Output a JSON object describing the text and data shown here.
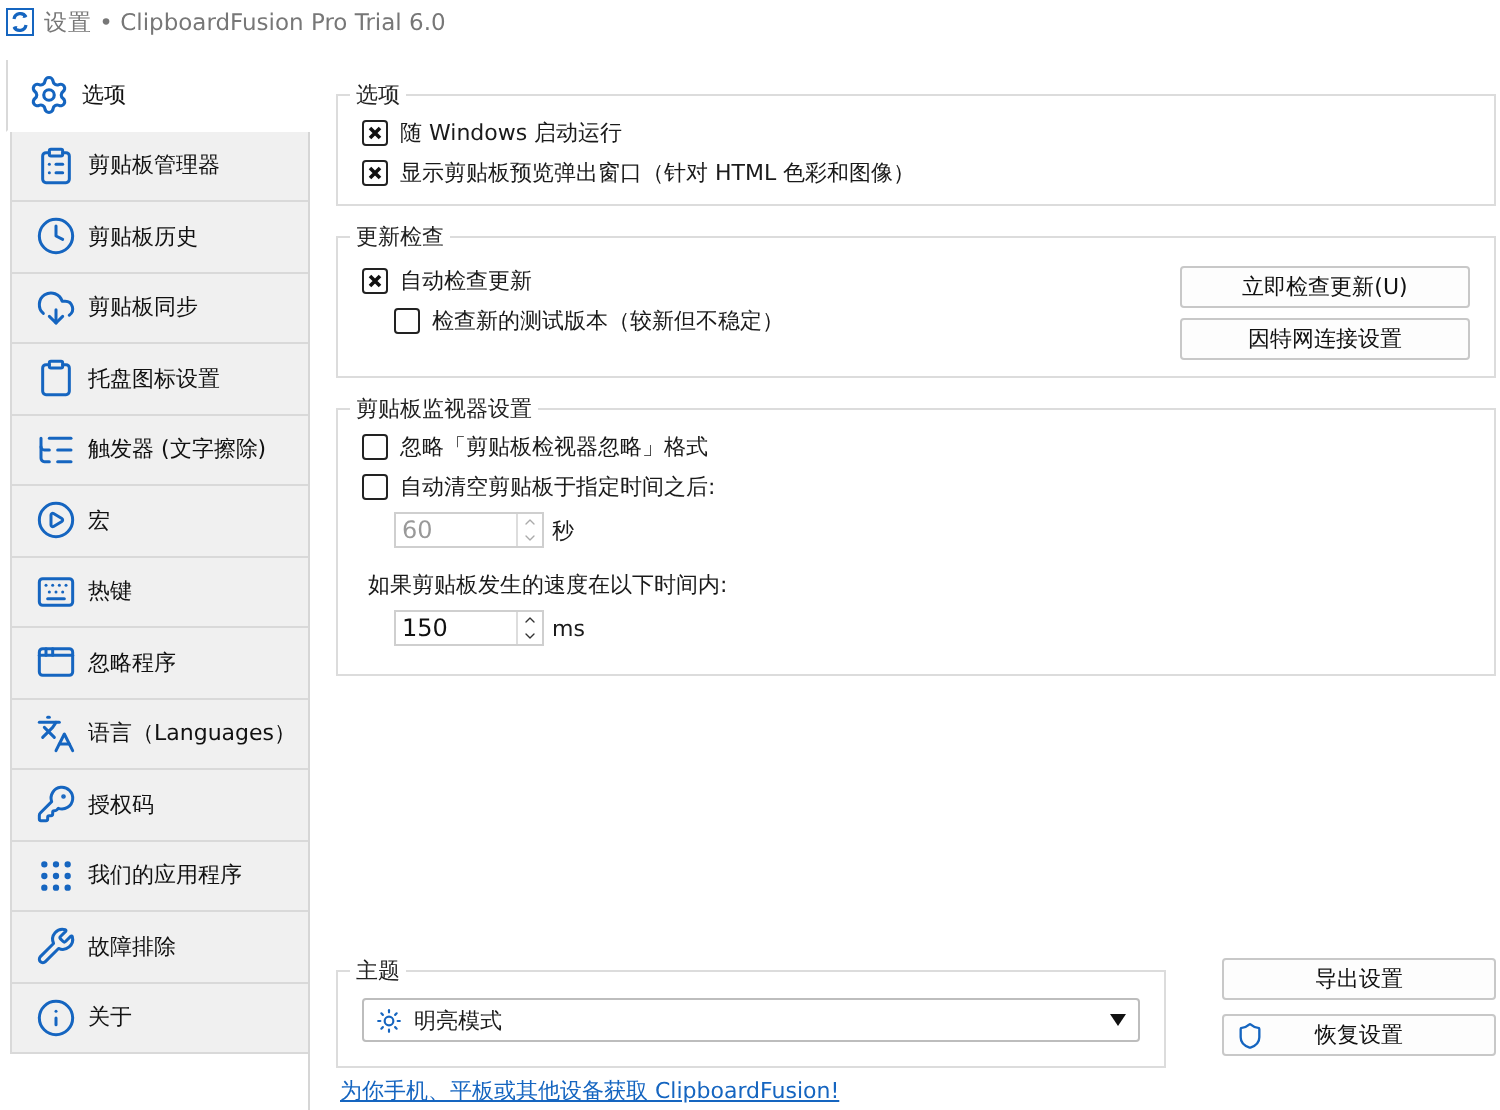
{
  "window": {
    "title": "设置 • ClipboardFusion Pro Trial 6.0"
  },
  "sidebar": {
    "items": [
      {
        "label": "选项",
        "selected": true
      },
      {
        "label": "剪贴板管理器",
        "selected": false
      },
      {
        "label": "剪贴板历史",
        "selected": false
      },
      {
        "label": "剪贴板同步",
        "selected": false
      },
      {
        "label": "托盘图标设置",
        "selected": false
      },
      {
        "label": "触发器 (文字擦除)",
        "selected": false
      },
      {
        "label": "宏",
        "selected": false
      },
      {
        "label": "热键",
        "selected": false
      },
      {
        "label": "忽略程序",
        "selected": false
      },
      {
        "label": "语言（Languages）",
        "selected": false
      },
      {
        "label": "授权码",
        "selected": false
      },
      {
        "label": "我们的应用程序",
        "selected": false
      },
      {
        "label": "故障排除",
        "selected": false
      },
      {
        "label": "关于",
        "selected": false
      }
    ]
  },
  "options": {
    "title": "选项",
    "checkboxes": [
      {
        "label": "随 Windows 启动运行",
        "checked": true
      },
      {
        "label": "显示剪贴板预览弹出窗口（针对 HTML 色彩和图像）",
        "checked": true
      }
    ]
  },
  "update_check": {
    "title": "更新检查",
    "checkboxes": [
      {
        "label": "自动检查更新",
        "checked": true,
        "children": [
          {
            "label": "检查新的测试版本（较新但不稳定）",
            "checked": false
          }
        ]
      }
    ],
    "buttons": [
      "立即检查更新(U)",
      "因特网连接设置"
    ]
  },
  "monitor": {
    "title": "剪贴板监视器设置",
    "checkboxes": [
      {
        "label": "忽略「剪贴板检视器忽略」格式",
        "checked": false
      },
      {
        "label": "自动清空剪贴板于指定时间之后:",
        "checked": false,
        "spinner": {
          "value": "60",
          "unit": "秒",
          "disabled": true
        }
      }
    ],
    "speed_label": "如果剪贴板发生的速度在以下时间内:",
    "speed_spinner": {
      "value": "150",
      "unit": "ms",
      "disabled": false
    }
  },
  "theme": {
    "title": "主题",
    "dropdown": {
      "value": "明亮模式"
    }
  },
  "buttons": [
    "导出设置",
    "恢复设置"
  ],
  "link": "为你手机、平板或其他设备获取 ClipboardFusion!"
}
